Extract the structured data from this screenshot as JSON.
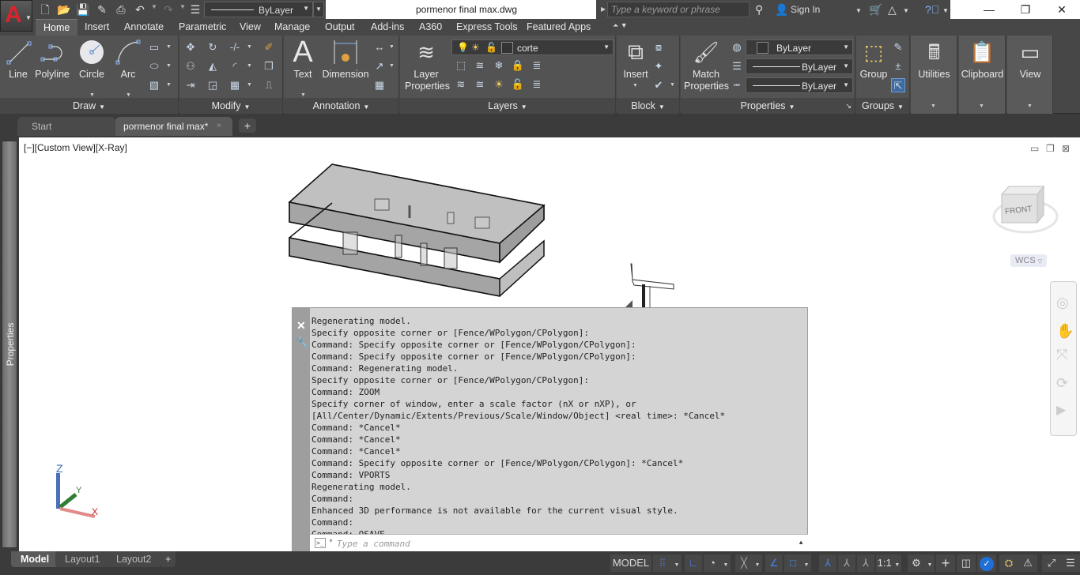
{
  "app": {
    "logo_letter": "A",
    "document_title": "pormenor final max.dwg"
  },
  "quick_access": {
    "icons": [
      "new-icon",
      "open-icon",
      "save-icon",
      "save-as-icon",
      "plot-icon",
      "undo-icon",
      "redo-icon",
      "lineweight-icon"
    ],
    "lineweight_value": "ByLayer"
  },
  "search": {
    "placeholder": "Type a keyword or phrase",
    "signin_label": "Sign In"
  },
  "ribbon_tabs": [
    {
      "label": "Home",
      "active": true
    },
    {
      "label": "Insert"
    },
    {
      "label": "Annotate"
    },
    {
      "label": "Parametric"
    },
    {
      "label": "View"
    },
    {
      "label": "Manage"
    },
    {
      "label": "Output"
    },
    {
      "label": "Add-ins"
    },
    {
      "label": "A360"
    },
    {
      "label": "Express Tools"
    },
    {
      "label": "Featured Apps"
    }
  ],
  "panels": {
    "draw": {
      "title": "Draw",
      "buttons": [
        "Line",
        "Polyline",
        "Circle",
        "Arc"
      ]
    },
    "modify": {
      "title": "Modify"
    },
    "annotation": {
      "title": "Annotation",
      "buttons": [
        "Text",
        "Dimension"
      ]
    },
    "layers": {
      "title": "Layers",
      "button_line1": "Layer",
      "button_line2": "Properties",
      "current_layer": "corte"
    },
    "block": {
      "title": "Block",
      "button": "Insert"
    },
    "properties": {
      "title": "Properties",
      "match_line1": "Match",
      "match_line2": "Properties",
      "color": "ByLayer",
      "linetype": "ByLayer",
      "lineweight": "ByLayer"
    },
    "groups": {
      "title": "Groups",
      "button": "Group"
    },
    "utilities": {
      "title": "Utilities"
    },
    "clipboard": {
      "title": "Clipboard"
    },
    "view": {
      "title": "View"
    }
  },
  "file_tabs": {
    "start": "Start",
    "active": "pormenor final max*",
    "close": "×",
    "add": "+"
  },
  "viewport": {
    "label": "[−][Custom View][X-Ray]",
    "viewcube_face": "FRONT",
    "ucs_label": "WCS",
    "ucs_axes": {
      "x": "X",
      "y": "Y",
      "z": "Z"
    }
  },
  "properties_palette": {
    "label": "Properties"
  },
  "command_window": {
    "history": [
      "Regenerating model.",
      "Specify opposite corner or [Fence/WPolygon/CPolygon]:",
      "Command: Specify opposite corner or [Fence/WPolygon/CPolygon]:",
      "Command: Specify opposite corner or [Fence/WPolygon/CPolygon]:",
      "Command: Regenerating model.",
      "Specify opposite corner or [Fence/WPolygon/CPolygon]:",
      "Command: ZOOM",
      "Specify corner of window, enter a scale factor (nX or nXP), or",
      "[All/Center/Dynamic/Extents/Previous/Scale/Window/Object] <real time>: *Cancel*",
      "Command: *Cancel*",
      "Command: *Cancel*",
      "Command: *Cancel*",
      "Command: Specify opposite corner or [Fence/WPolygon/CPolygon]: *Cancel*",
      "Command: VPORTS",
      "Regenerating model.",
      "Command:",
      "Enhanced 3D performance is not available for the current visual style.",
      "Command:",
      "Command: QSAVE"
    ],
    "input_placeholder": "Type a command"
  },
  "layout_tabs": [
    {
      "label": "Model",
      "active": true
    },
    {
      "label": "Layout1"
    },
    {
      "label": "Layout2"
    }
  ],
  "layout_add": "+",
  "status_bar": {
    "mode": "MODEL",
    "annotation_scale": "1:1"
  }
}
